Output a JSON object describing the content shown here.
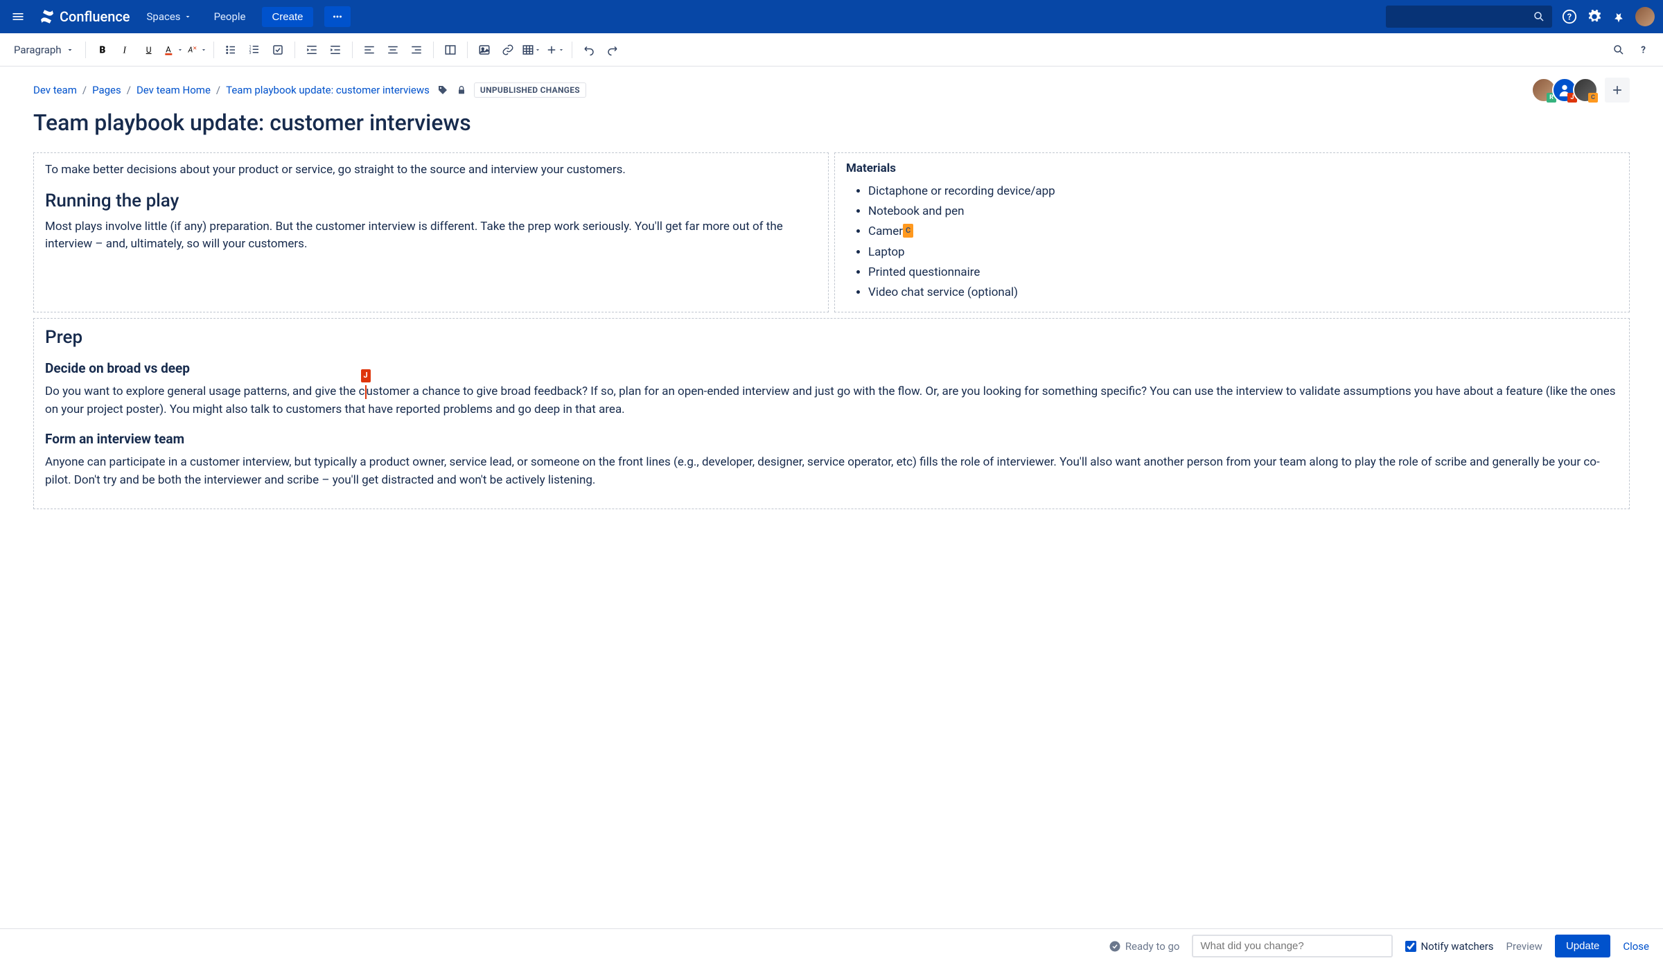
{
  "topnav": {
    "logo": "Confluence",
    "spaces": "Spaces",
    "people": "People",
    "create": "Create"
  },
  "toolbar": {
    "format": "Paragraph"
  },
  "breadcrumb": {
    "items": [
      "Dev team",
      "Pages",
      "Dev team Home",
      "Team playbook update: customer interviews"
    ],
    "status": "UNPUBLISHED CHANGES"
  },
  "collaborators": [
    {
      "badge": "R",
      "badgeColor": "#36b37e"
    },
    {
      "badge": "J",
      "badgeColor": "#de350b"
    },
    {
      "badge": "C",
      "badgeColor": "#ff991f"
    }
  ],
  "page": {
    "title": "Team playbook update: customer interviews",
    "intro": "To make better decisions about your product or service, go straight to the source and interview your customers.",
    "h2_running": "Running the play",
    "running_body": "Most plays involve little (if any) preparation. But the customer interview is different. Take the prep work seriously. You'll get far more out of the interview – and, ultimately, so will your customers.",
    "materials_title": "Materials",
    "materials": [
      "Dictaphone or recording device/app",
      "Notebook and pen",
      "Camera",
      "Laptop",
      "Printed questionnaire",
      "Video chat service (optional)"
    ],
    "h2_prep": "Prep",
    "h3_decide": "Decide on broad vs deep",
    "decide_body_pre": "Do you want to explore general usage patterns, and give the c",
    "decide_body_post": "ustomer a chance to give broad feedback? If so, plan for an open-ended interview and just go with the flow. Or, are you looking for something specific? You can use the interview to validate assumptions you have about a feature (like the ones on your project poster). You might also talk to customers that have reported problems and go deep in that area.",
    "h3_form": "Form an interview team",
    "form_body": "Anyone can participate in a customer interview, but typically a product owner, service lead, or someone on the front lines (e.g., developer, designer, service operator, etc) fills the role of interviewer. You'll also want another person from your team along to play the role of scribe and generally be your co-pilot. Don't try and be both the interviewer and scribe – you'll get distracted and won't be actively listening."
  },
  "footer": {
    "ready": "Ready to go",
    "change_placeholder": "What did you change?",
    "notify": "Notify watchers",
    "preview": "Preview",
    "update": "Update",
    "close": "Close"
  },
  "cursors": {
    "j": "J",
    "c": "C"
  }
}
